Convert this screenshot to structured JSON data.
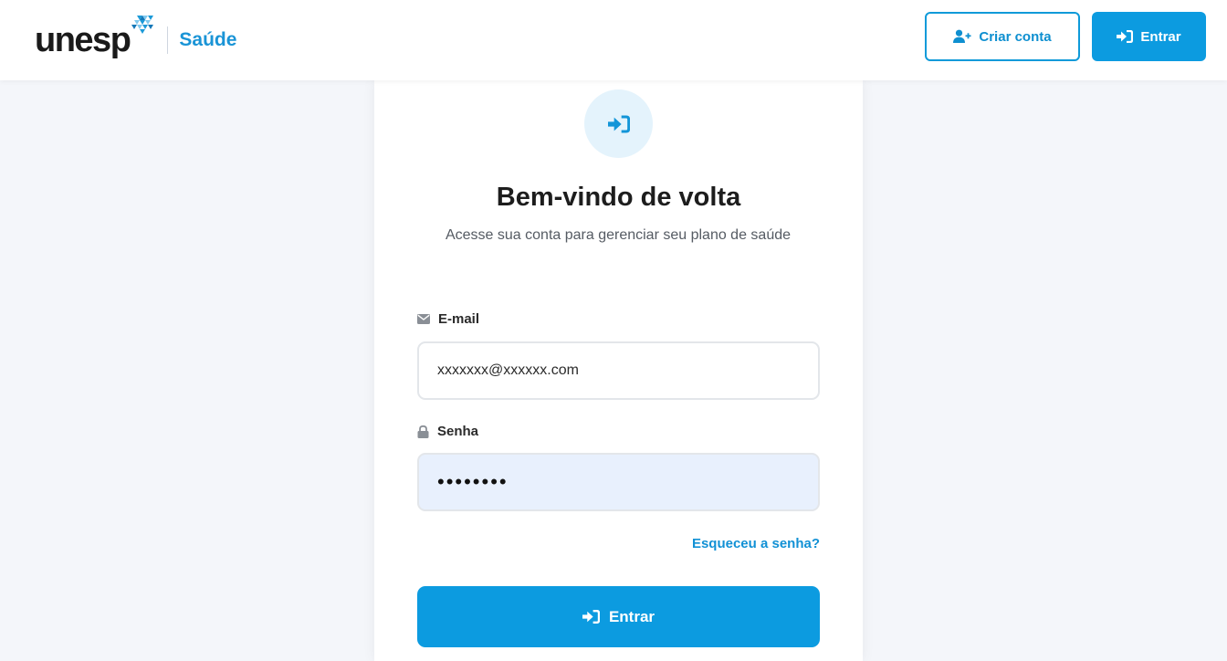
{
  "header": {
    "brand_name": "unesp",
    "brand_sub": "Saúde",
    "create_account_label": "Criar conta",
    "login_label": "Entrar"
  },
  "login_card": {
    "title": "Bem-vindo de volta",
    "subtitle": "Acesse sua conta para gerenciar seu plano de saúde",
    "email_label": "E-mail",
    "email_value": "xxxxxxx@xxxxxx.com",
    "password_label": "Senha",
    "password_value": "••••••••",
    "forgot_label": "Esqueceu a senha?",
    "submit_label": "Entrar"
  },
  "icons": {
    "hero": "sign-in-icon",
    "email": "envelope-icon",
    "password": "lock-icon",
    "create_account": "user-plus-icon",
    "login": "sign-in-icon"
  },
  "colors": {
    "accent": "#0c9be0",
    "brand_sub": "#1a94d6",
    "password_field_bg": "#e8f0fd",
    "background": "#f4f6fa"
  }
}
